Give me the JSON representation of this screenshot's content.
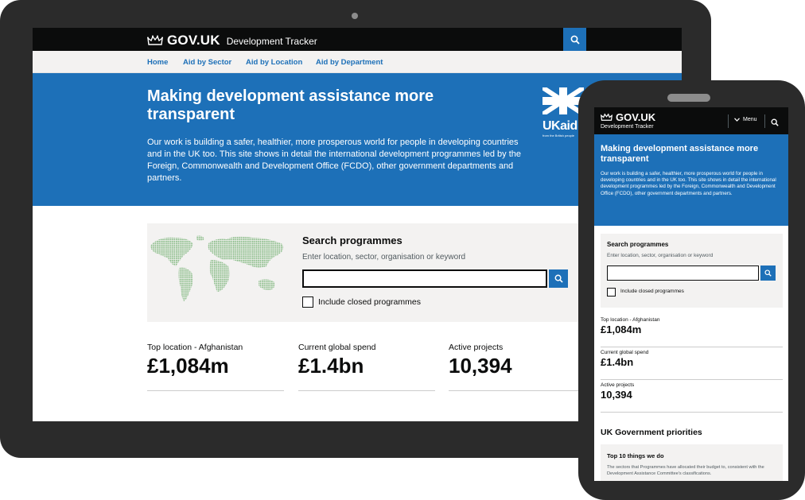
{
  "site": {
    "logo": "GOV.UK",
    "service_name": "Development Tracker"
  },
  "nav": {
    "items": [
      "Home",
      "Aid by Sector",
      "Aid by Location",
      "Aid by Department"
    ]
  },
  "hero": {
    "title": "Making development assistance more transparent",
    "body": "Our work is building a safer, healthier, more prosperous world for people in developing countries and in the UK too. This site shows in detail the international development programmes led by the Foreign, Commonwealth and Development Office (FCDO), other government departments and partners."
  },
  "ukaid": {
    "text": "UKaid",
    "tagline": "from the British people"
  },
  "search": {
    "title": "Search programmes",
    "hint": "Enter location, sector, organisation or keyword",
    "input_value": "",
    "checkbox_label": "Include closed programmes",
    "checkbox_checked": false
  },
  "stats": [
    {
      "label": "Top location - Afghanistan",
      "value": "£1,084m"
    },
    {
      "label": "Current global spend",
      "value": "£1.4bn"
    },
    {
      "label": "Active projects",
      "value": "10,394"
    }
  ],
  "mobile": {
    "menu_label": "Menu",
    "priorities_heading": "UK Government priorities",
    "card_title": "Top 10 things we do",
    "card_body": "The sectors that Programmes have allocated their budget to, consistent with the Development Assistance Committee's classifications."
  },
  "colors": {
    "brand_blue": "#1d70b8",
    "header_black": "#0b0c0c",
    "panel_grey": "#f3f2f1",
    "device_frame": "#2b2b2b",
    "map_green": "#7fb77e"
  },
  "icons": [
    "crown-icon",
    "search-icon",
    "chevron-down-icon",
    "union-flag-icon",
    "world-map"
  ]
}
